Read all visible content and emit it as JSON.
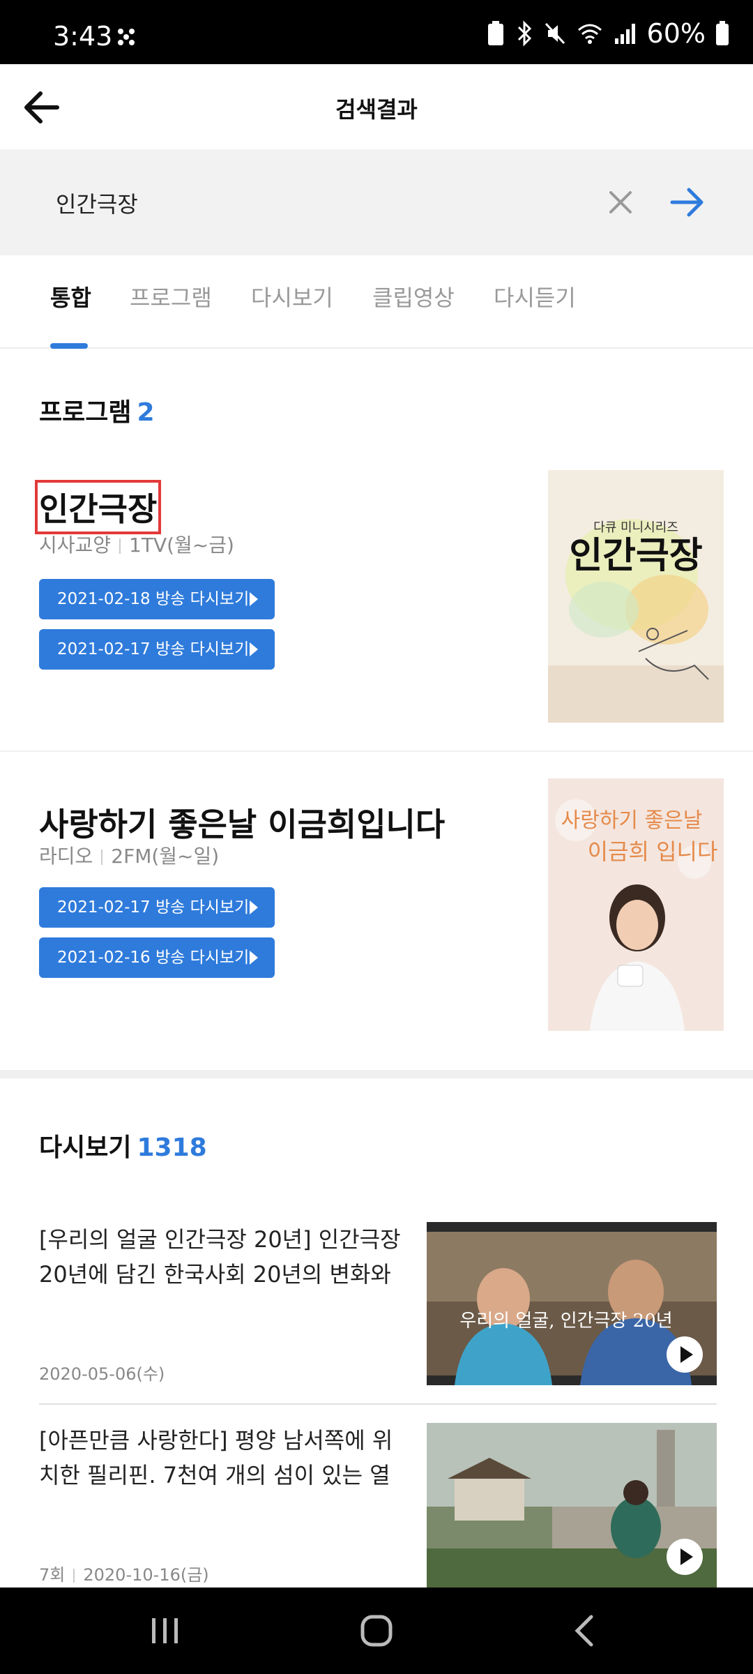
{
  "status_bar": {
    "time": "3:43",
    "battery_percent": "60%"
  },
  "header": {
    "title": "검색결과"
  },
  "search": {
    "query": "인간극장"
  },
  "tabs": [
    {
      "label": "통합",
      "active": true
    },
    {
      "label": "프로그램"
    },
    {
      "label": "다시보기"
    },
    {
      "label": "클립영상"
    },
    {
      "label": "다시듣기"
    }
  ],
  "programs_section": {
    "title": "프로그램",
    "count": "2"
  },
  "programs": [
    {
      "title": "인간극장",
      "genre": "시사교양",
      "channel": "1TV(월~금)",
      "buttons": [
        "2021-02-18 방송 다시보기",
        "2021-02-17 방송 다시보기"
      ],
      "thumb_caption": "다큐 미니시리즈",
      "thumb_title": "인간극장"
    },
    {
      "title": "사랑하기 좋은날 이금희입니다",
      "genre": "라디오",
      "channel": "2FM(월~일)",
      "buttons": [
        "2021-02-17 방송 다시보기",
        "2021-02-16 방송 다시보기"
      ],
      "thumb_line1": "사랑하기 좋은날",
      "thumb_line2": "이금희 입니다"
    }
  ],
  "vod_section": {
    "title": "다시보기",
    "count": "1318"
  },
  "vods": [
    {
      "title": "[우리의 얼굴 인간극장 20년] 인간극장 20년에 담긴 한국사회 20년의 변화와 우…",
      "date": "2020-05-06(수)",
      "thumb_text": "우리의 얼굴, 인간극장 20년"
    },
    {
      "title": "[아픈만큼 사랑한다] 평양 남서쪽에 위치한 필리핀. 7천여 개의 섬이 있는 열대 …",
      "episode": "7회",
      "date": "2020-10-16(금)"
    }
  ],
  "colors": {
    "accent": "#2f7bdc",
    "highlight_box": "#e23a3a"
  }
}
